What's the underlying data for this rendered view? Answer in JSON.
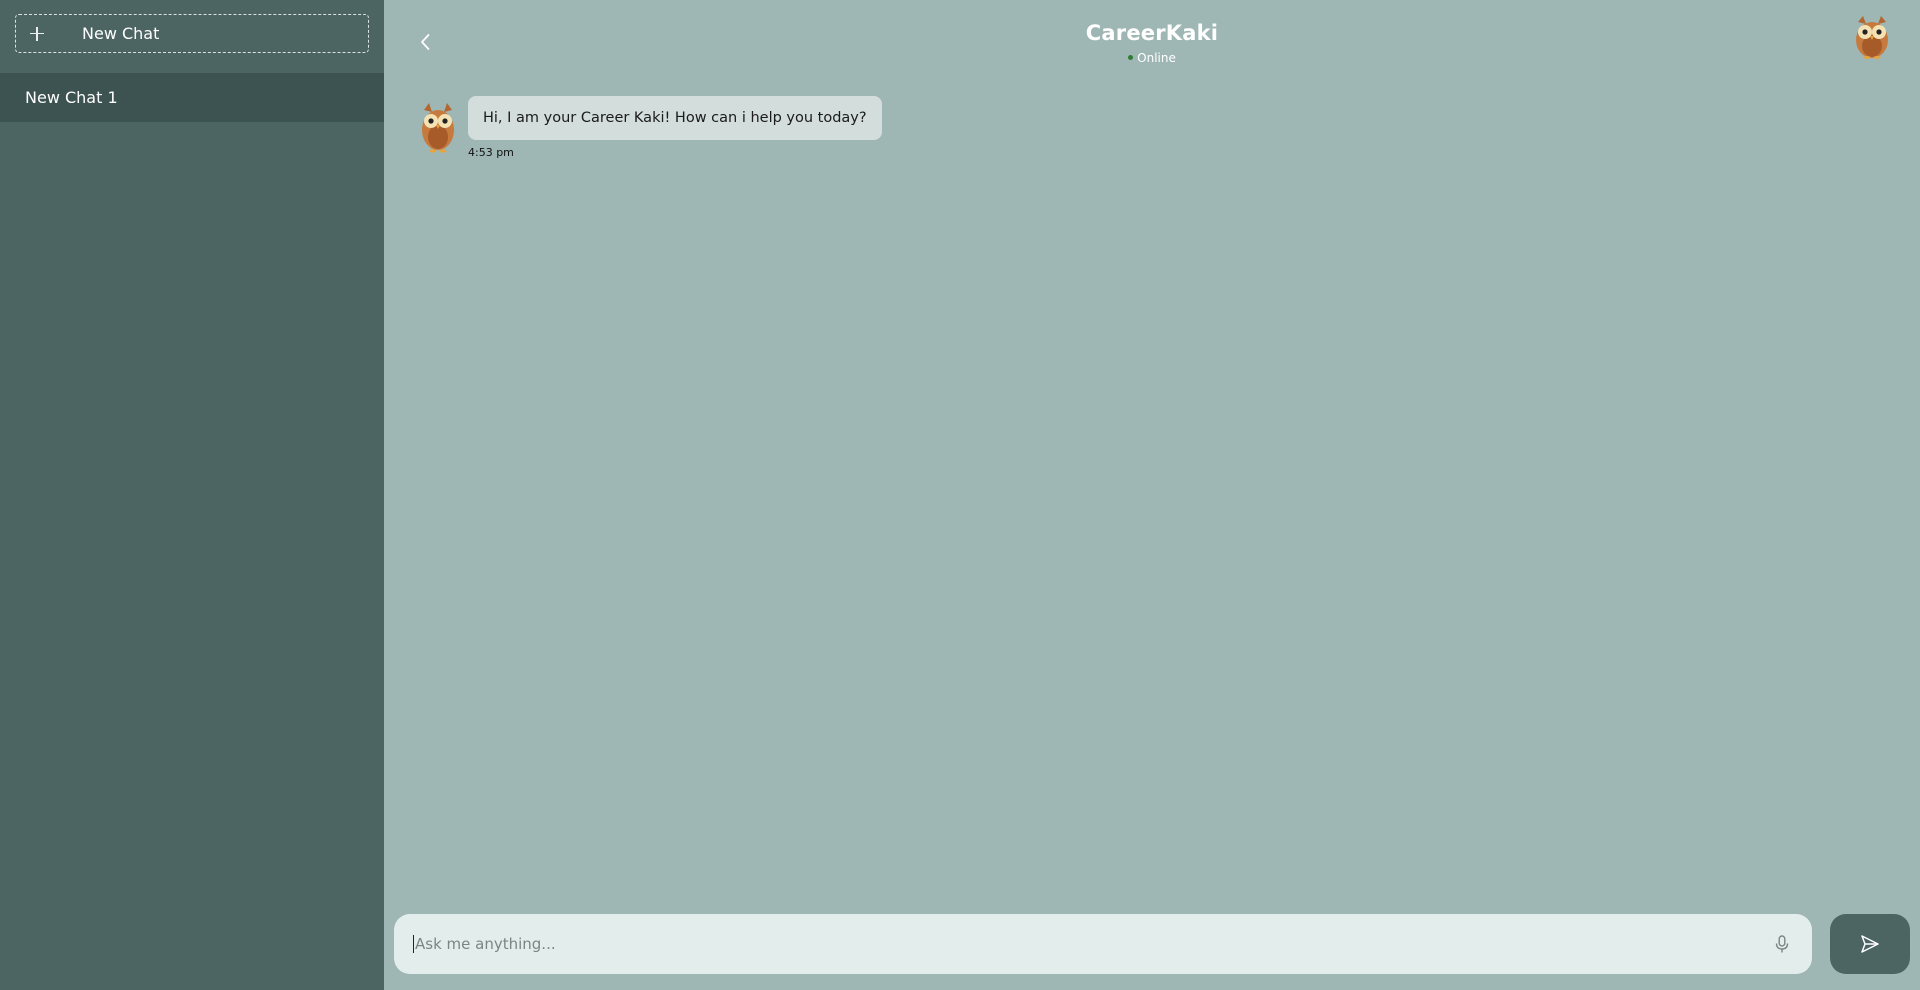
{
  "sidebar": {
    "new_chat_label": "New Chat",
    "chats": [
      {
        "label": "New Chat 1"
      }
    ]
  },
  "header": {
    "title": "CareerKaki",
    "status": "Online"
  },
  "messages": [
    {
      "text": "Hi, I am your Career Kaki! How can i help you today?",
      "time": "4:53 pm"
    }
  ],
  "composer": {
    "placeholder": "Ask me anything...",
    "value": ""
  },
  "icons": {
    "plus": "plus-icon",
    "back": "chevron-left-icon",
    "avatar": "owl-avatar-icon",
    "mic": "microphone-icon",
    "send": "send-icon"
  },
  "colors": {
    "sidebar_bg": "#4c6462",
    "selected_chat_bg": "#3d5351",
    "main_bg": "#9eb7b4",
    "bubble_bg": "#d2dddc",
    "composer_bg": "#e3eeec",
    "send_button_bg": "#4c6462",
    "status_dot": "#2f7d32"
  }
}
